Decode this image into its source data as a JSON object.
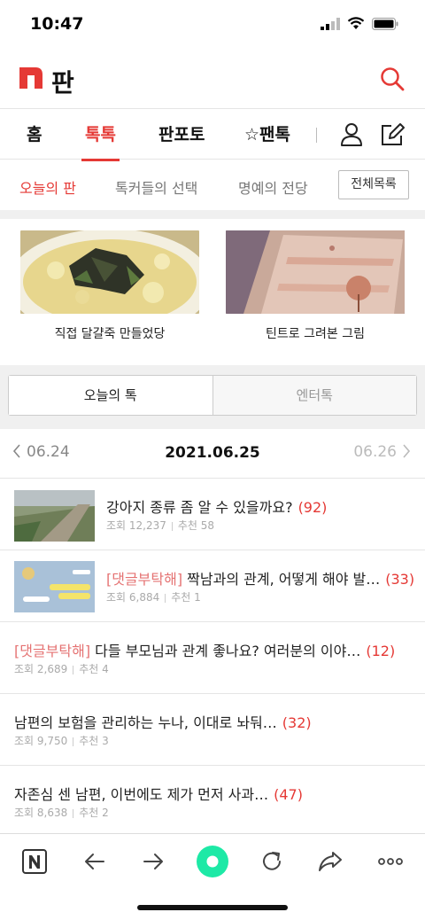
{
  "status": {
    "time": "10:47"
  },
  "logo": {
    "text": "판"
  },
  "nav": {
    "items": [
      {
        "label": "홈"
      },
      {
        "label": "톡톡"
      },
      {
        "label": "판포토"
      },
      {
        "label": "☆팬톡"
      }
    ]
  },
  "subnav": {
    "items": [
      {
        "label": "오늘의 판"
      },
      {
        "label": "톡커들의 선택"
      },
      {
        "label": "명예의 전당"
      }
    ],
    "all_button": "전체목록"
  },
  "featured": [
    {
      "caption": "직접 달걀죽 만들었당"
    },
    {
      "caption": "틴트로 그려본 그림"
    }
  ],
  "segment": {
    "tab1": "오늘의 톡",
    "tab2": "엔터톡"
  },
  "date": {
    "prev": "06.24",
    "current": "2021.06.25",
    "next": "06.26"
  },
  "posts": [
    {
      "tag": "",
      "title": "강아지 종류 좀 알 수 있을까요?",
      "count": "(92)",
      "views": "조회 12,237",
      "recs": "추천 58"
    },
    {
      "tag": "[댓글부탁해]",
      "title": " 짝남과의 관계, 어떻게 해야 발…",
      "count": "(33)",
      "views": "조회 6,884",
      "recs": "추천 1"
    },
    {
      "tag": "[댓글부탁해]",
      "title": " 다들 부모님과 관계 좋나요? 여러분의 이야…",
      "count": "(12)",
      "views": "조회 2,689",
      "recs": "추천 4"
    },
    {
      "tag": "",
      "title": "남편의 보험을 관리하는 누나, 이대로 놔둬…",
      "count": "(32)",
      "views": "조회 9,750",
      "recs": "추천 3"
    },
    {
      "tag": "",
      "title": "자존심 센 남편, 이번에도 제가 먼저 사과…",
      "count": "(47)",
      "views": "조회 8,638",
      "recs": "추천 2"
    }
  ],
  "colors": {
    "accent": "#e53935",
    "green": "#1de9a6"
  }
}
